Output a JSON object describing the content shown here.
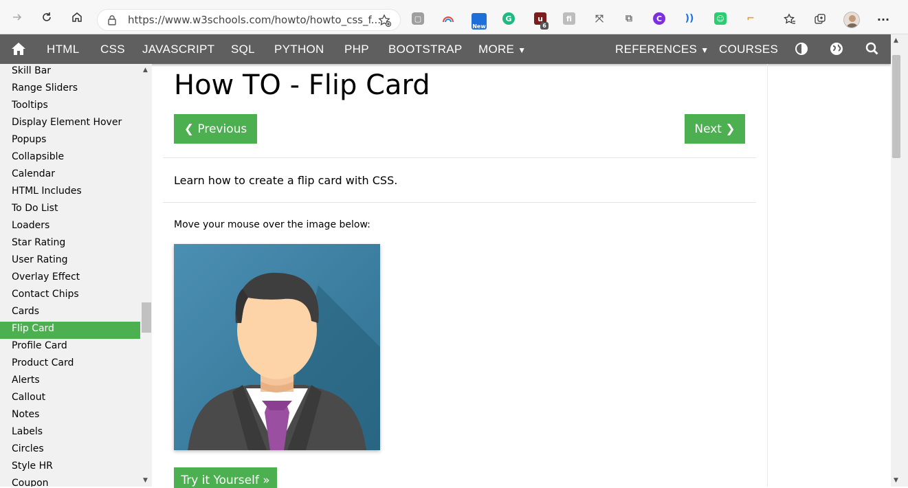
{
  "browser": {
    "url": "https://www.w3schools.com/howto/howto_css_f...",
    "new_badge": "New",
    "ext_badge_count": "6"
  },
  "topnav": {
    "items": [
      "HTML",
      "CSS",
      "JAVASCRIPT",
      "SQL",
      "PYTHON",
      "PHP",
      "BOOTSTRAP",
      "MORE",
      "REFERENCES",
      "COURSES"
    ]
  },
  "sidebar": {
    "items": [
      "Skill Bar",
      "Range Sliders",
      "Tooltips",
      "Display Element Hover",
      "Popups",
      "Collapsible",
      "Calendar",
      "HTML Includes",
      "To Do List",
      "Loaders",
      "Star Rating",
      "User Rating",
      "Overlay Effect",
      "Contact Chips",
      "Cards",
      "Flip Card",
      "Profile Card",
      "Product Card",
      "Alerts",
      "Callout",
      "Notes",
      "Labels",
      "Circles",
      "Style HR",
      "Coupon"
    ],
    "active": "Flip Card"
  },
  "main": {
    "title": "How TO - Flip Card",
    "previous_label": "❮ Previous",
    "next_label": "Next ❯",
    "intro": "Learn how to create a flip card with CSS.",
    "hint": "Move your mouse over the image below:",
    "try_label": "Try it Yourself »"
  },
  "colors": {
    "accent_green": "#4caf50",
    "nav_gray": "#5f5f5f",
    "sidebar_bg": "#f1f1f1"
  }
}
